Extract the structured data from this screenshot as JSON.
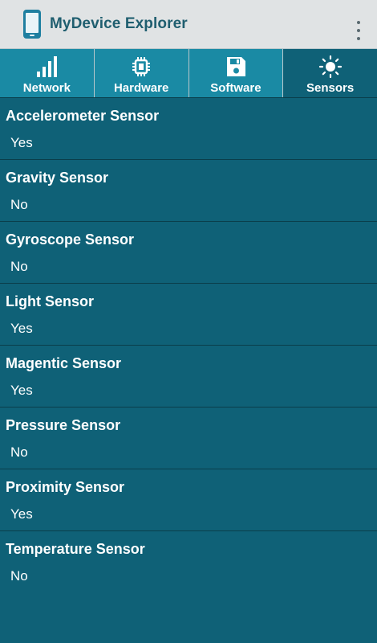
{
  "app": {
    "title": "MyDevice Explorer",
    "icon": "phone-icon",
    "menu_icon": "overflow-menu-icon"
  },
  "tabs": [
    {
      "label": "Network",
      "icon": "signal-bars-icon",
      "active": false
    },
    {
      "label": "Hardware",
      "icon": "chip-icon",
      "active": false
    },
    {
      "label": "Software",
      "icon": "floppy-disk-icon",
      "active": false
    },
    {
      "label": "Sensors",
      "icon": "sun-icon",
      "active": true
    }
  ],
  "sensors": [
    {
      "name": "Accelerometer Sensor",
      "value": "Yes"
    },
    {
      "name": "Gravity Sensor",
      "value": "No"
    },
    {
      "name": "Gyroscope Sensor",
      "value": "No"
    },
    {
      "name": "Light Sensor",
      "value": "Yes"
    },
    {
      "name": "Magentic Sensor",
      "value": "Yes"
    },
    {
      "name": "Pressure Sensor",
      "value": "No"
    },
    {
      "name": "Proximity Sensor",
      "value": "Yes"
    },
    {
      "name": "Temperature Sensor",
      "value": "No"
    }
  ],
  "colors": {
    "action_bar_bg": "#e0e3e4",
    "title_color": "#1f5e6f",
    "tab_bg": "#1a8aa4",
    "tab_active_bg": "#0f6177",
    "content_bg": "#0f6177"
  }
}
